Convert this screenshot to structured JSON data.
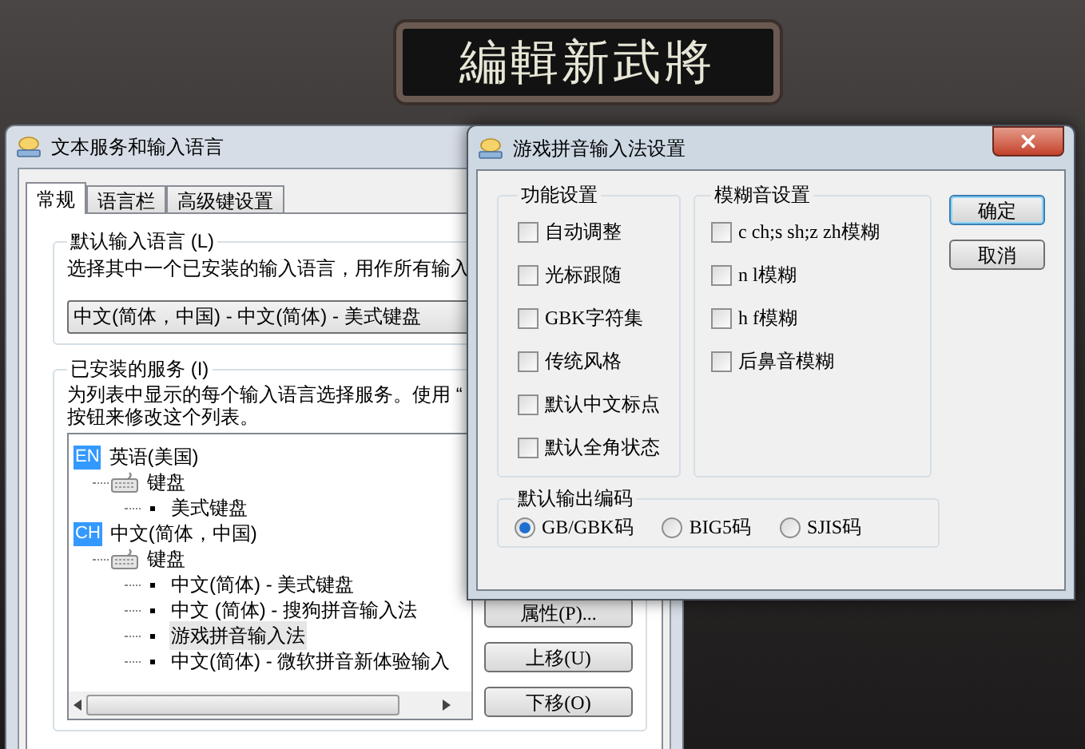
{
  "background": {
    "banner": "編輯新武將"
  },
  "main_window": {
    "title": "文本服务和输入语言",
    "tabs": [
      {
        "label": "常规",
        "selected": true
      },
      {
        "label": "语言栏",
        "selected": false
      },
      {
        "label": "高级键设置",
        "selected": false
      }
    ],
    "default_language": {
      "title": "默认输入语言 (L)",
      "description": "选择其中一个已安装的输入语言，用作所有输入",
      "value": "中文(简体，中国) - 中文(简体) - 美式键盘"
    },
    "installed_services": {
      "title": "已安装的服务 (I)",
      "description": [
        "为列表中显示的每个输入语言选择服务。使用 “",
        "按钮来修改这个列表。"
      ],
      "tree": [
        {
          "badge": "EN",
          "label": "英语(美国)",
          "children": [
            {
              "label": "键盘",
              "children": [
                {
                  "label": "美式键盘",
                  "selected": false
                }
              ]
            }
          ]
        },
        {
          "badge": "CH",
          "label": "中文(简体，中国)",
          "children": [
            {
              "label": "键盘",
              "children": [
                {
                  "label": "中文(简体) - 美式键盘",
                  "selected": false
                },
                {
                  "label": "中文 (简体) - 搜狗拼音输入法",
                  "selected": false
                },
                {
                  "label": "游戏拼音输入法",
                  "selected": true
                },
                {
                  "label": "中文(简体) - 微软拼音新体验输入",
                  "selected": false
                }
              ]
            }
          ]
        }
      ],
      "buttons": [
        "属性(P)...",
        "上移(U)",
        "下移(O)"
      ]
    }
  },
  "dialog": {
    "title": "游戏拼音输入法设置",
    "function_settings": {
      "title": "功能设置",
      "options": [
        {
          "label": "自动调整",
          "checked": false
        },
        {
          "label": "光标跟随",
          "checked": false
        },
        {
          "label": "GBK字符集",
          "checked": false
        },
        {
          "label": "传统风格",
          "checked": false
        },
        {
          "label": "默认中文标点",
          "checked": false
        },
        {
          "label": "默认全角状态",
          "checked": false
        }
      ]
    },
    "fuzzy_settings": {
      "title": "模糊音设置",
      "options": [
        {
          "label": "c ch;s sh;z zh模糊",
          "checked": false
        },
        {
          "label": "n l模糊",
          "checked": false
        },
        {
          "label": "h f模糊",
          "checked": false
        },
        {
          "label": "后鼻音模糊",
          "checked": false
        }
      ]
    },
    "output_encoding": {
      "title": "默认输出编码",
      "options": [
        {
          "label": "GB/GBK码",
          "selected": true
        },
        {
          "label": "BIG5码",
          "selected": false
        },
        {
          "label": "SJIS码",
          "selected": false
        }
      ]
    },
    "buttons": [
      {
        "label": "确定",
        "default": true
      },
      {
        "label": "取消",
        "default": false
      }
    ]
  }
}
